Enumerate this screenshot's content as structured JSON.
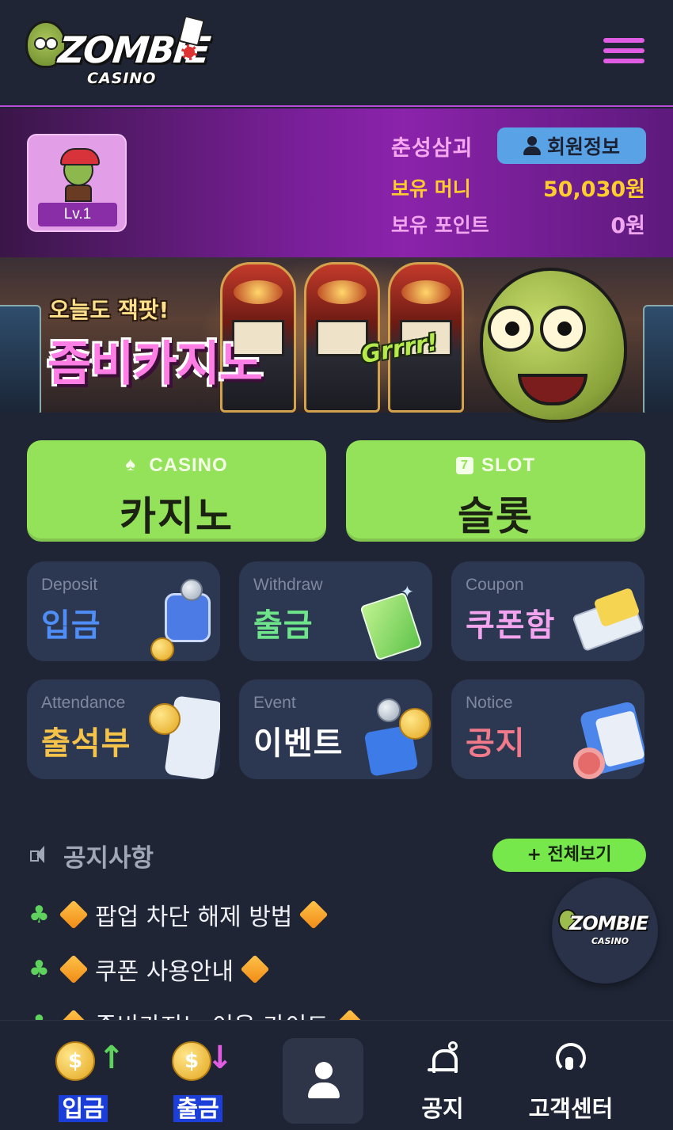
{
  "header": {
    "logo_word": "ZOMBIE",
    "logo_sub": "CASINO",
    "menu_icon": "hamburger-menu-icon"
  },
  "colors": {
    "background": "#1f2535",
    "accent_purple": "#b64fd6",
    "green_button": "#94e25a",
    "gold_text": "#ffcc2e",
    "pink_text": "#f0a5ee",
    "info_button": "#5aa2e6"
  },
  "profile": {
    "level": "Lv.1",
    "username": "춘성삼괴",
    "info_button_label": "회원정보",
    "money_label": "보유 머니",
    "money_value": "50,030원",
    "points_label": "보유 포인트",
    "points_value": "0원"
  },
  "banner": {
    "top_text": "오늘도 잭팟!",
    "main_text": "좀비카지노",
    "shout_text": "Grrrr!"
  },
  "games": [
    {
      "sub": "CASINO",
      "label": "카지노",
      "icon": "spade-icon"
    },
    {
      "sub": "SLOT",
      "label": "슬롯",
      "icon": "slot-seven-icon"
    }
  ],
  "tiles": [
    {
      "en": "Deposit",
      "ko": "입금",
      "color": "#4f8df7"
    },
    {
      "en": "Withdraw",
      "ko": "출금",
      "color": "#6ee58a"
    },
    {
      "en": "Coupon",
      "ko": "쿠폰함",
      "color": "#f2a5ee"
    },
    {
      "en": "Attendance",
      "ko": "출석부",
      "color": "#f5c34a"
    },
    {
      "en": "Event",
      "ko": "이벤트",
      "color": "#ffffff"
    },
    {
      "en": "Notice",
      "ko": "공지",
      "color": "#f07a8a"
    }
  ],
  "notice": {
    "title": "공지사항",
    "view_all": "+ 전체보기",
    "items": [
      "팝업 차단 해제 방법",
      "쿠폰 사용안내",
      "좀비카지노 이용 가이드"
    ]
  },
  "float_logo": {
    "word": "ZOMBIE",
    "sub": "CASINO"
  },
  "bottom_nav": [
    {
      "label": "입금",
      "icon": "deposit-coin-icon"
    },
    {
      "label": "출금",
      "icon": "withdraw-coin-icon"
    },
    {
      "label": "",
      "icon": "mypage-person-icon"
    },
    {
      "label": "공지",
      "icon": "bell-icon"
    },
    {
      "label": "고객센터",
      "icon": "headset-icon"
    }
  ]
}
